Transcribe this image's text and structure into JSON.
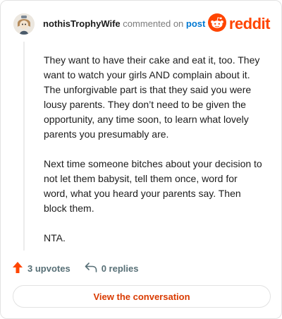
{
  "comment": {
    "author": "nothisTrophyWife",
    "action_text": "commented on",
    "post_link_label": "post",
    "brand": "reddit",
    "paragraphs": [
      "They want to have their cake and eat it, too. They want to watch your girls AND complain about it. The unforgivable part is that they said you were lousy parents. They don’t need to be given the opportunity, any time soon, to learn what lovely parents you presumably are.",
      "Next time someone bitches about your decision to not let them babysit, tell them once, word for word, what you heard your parents say. Then block them.",
      "NTA."
    ],
    "upvotes_label": "3 upvotes",
    "replies_label": "0 replies",
    "view_button_label": "View the conversation"
  },
  "colors": {
    "brand_orange": "#ff4500",
    "link_blue": "#0079d3",
    "button_text": "#d93a00"
  },
  "icons": {
    "avatar": "avatar-icon",
    "logo": "reddit-logo-icon",
    "upvote": "upvote-arrow-icon",
    "reply": "reply-arrow-icon"
  }
}
